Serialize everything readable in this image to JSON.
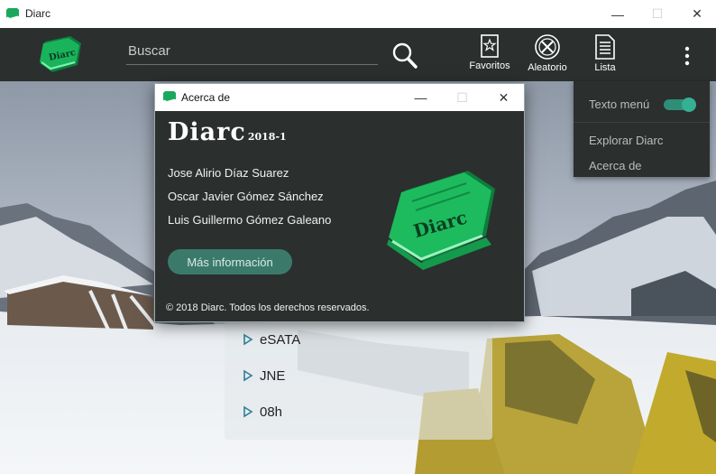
{
  "window": {
    "title": "Diarc",
    "minimize": "—",
    "maximize": "☐",
    "close": "✕"
  },
  "toolbar": {
    "logo_text": "Diarc",
    "search": {
      "placeholder": "Buscar",
      "value": ""
    },
    "buttons": [
      {
        "label": "Favoritos",
        "icon": "star-document-icon"
      },
      {
        "label": "Aleatorio",
        "icon": "random-wheel-icon"
      },
      {
        "label": "Lista",
        "icon": "list-document-icon"
      }
    ]
  },
  "menu": {
    "toggle_label": "Texto menú",
    "toggle_on": true,
    "items": [
      "Explorar Diarc",
      "Acerca de"
    ]
  },
  "list": {
    "items": [
      "eSATA",
      "JNE",
      "08h"
    ]
  },
  "dialog": {
    "title": "Acerca de",
    "brand": "Diarc",
    "version": "2018-1",
    "authors": [
      "Jose Alirio Díaz Suarez",
      "Oscar Javier Gómez Sánchez",
      "Luis Guillermo Gómez Galeano"
    ],
    "more_info_label": "Más información",
    "copyright": "© 2018 Diarc. Todos los derechos reservados.",
    "book_text": "Diarc"
  },
  "colors": {
    "toolbar_bg": "#2b2f2e",
    "accent": "#18a85a",
    "toggle": "#35b093",
    "button_bg": "#3b7a6a"
  }
}
